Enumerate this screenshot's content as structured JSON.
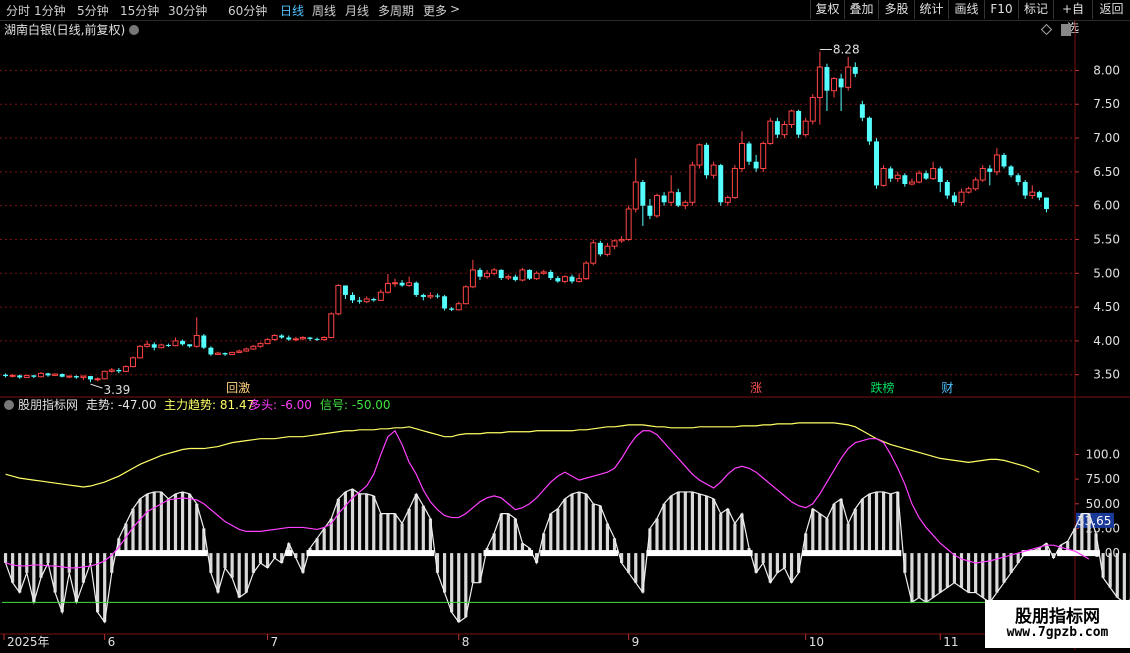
{
  "toolbar": {
    "periods": [
      {
        "label": "分时",
        "active": false
      },
      {
        "label": "1分钟",
        "active": false
      },
      {
        "label": "5分钟",
        "active": false
      },
      {
        "label": "15分钟",
        "active": false
      },
      {
        "label": "30分钟",
        "active": false
      },
      {
        "label": "60分钟",
        "active": false
      },
      {
        "label": "日线",
        "active": true
      },
      {
        "label": "周线",
        "active": false
      },
      {
        "label": "月线",
        "active": false
      },
      {
        "label": "多周期",
        "active": false
      },
      {
        "label": "更多",
        "active": false
      }
    ],
    "more_arrow": ">",
    "right_buttons": [
      "复权",
      "叠加",
      "多股",
      "统计",
      "画线",
      "F10",
      "标记",
      "+自选",
      "返回"
    ]
  },
  "main_chart": {
    "title": "湖南白银(日线,前复权)",
    "price_axis": [
      "8.00",
      "7.50",
      "7.00",
      "6.50",
      "6.00",
      "5.50",
      "5.00",
      "4.50",
      "4.00",
      "3.50"
    ],
    "high_label": "8.28",
    "low_label": "3.39",
    "events": [
      {
        "label": "回激",
        "color": "#ffd27a",
        "index": 32
      },
      {
        "label": "涨",
        "color": "#ff5050",
        "index": 106
      },
      {
        "label": "跌榜",
        "color": "#00e060",
        "index": 123
      },
      {
        "label": "财",
        "color": "#4ec3ff",
        "index": 133
      }
    ]
  },
  "indicator": {
    "name": "股朋指标网",
    "values": [
      {
        "label": "走势:",
        "value": "-47.00",
        "color": "#e6e6e6"
      },
      {
        "label": "主力趋势:",
        "value": "81.47",
        "color": "#ffff66"
      },
      {
        "label": "多头:",
        "value": "-6.00",
        "color": "#ff40ff"
      },
      {
        "label": "信号:",
        "value": "-50.00",
        "color": "#40e040"
      }
    ],
    "axis": [
      "100.0",
      "75.00",
      "50.00",
      "25.00",
      "0.00"
    ],
    "current_value": "33.65"
  },
  "time_axis": [
    {
      "label": "2025年",
      "index": 0
    },
    {
      "label": "6",
      "index": 14
    },
    {
      "label": "7",
      "index": 37
    },
    {
      "label": "8",
      "index": 64
    },
    {
      "label": "9",
      "index": 88
    },
    {
      "label": "10",
      "index": 113
    },
    {
      "label": "11",
      "index": 132
    }
  ],
  "watermark": {
    "line1": "股朋指标网",
    "line2": "www.7gpzb.com"
  },
  "colors": {
    "up": "#ff4444",
    "down": "#54ffff",
    "trend": "#ffff66",
    "bull": "#ff40ff",
    "signal": "#40e040",
    "grid": "#7a1010"
  },
  "chart_data": {
    "type": "candlestick",
    "title": "湖南白银(日线,前复权)",
    "ylim": [
      3.2,
      8.45
    ],
    "candles": [
      [
        3.5,
        3.48,
        3.52,
        3.46
      ],
      [
        3.48,
        3.49,
        3.51,
        3.46
      ],
      [
        3.49,
        3.46,
        3.5,
        3.44
      ],
      [
        3.46,
        3.49,
        3.5,
        3.45
      ],
      [
        3.49,
        3.47,
        3.5,
        3.45
      ],
      [
        3.47,
        3.52,
        3.54,
        3.46
      ],
      [
        3.52,
        3.49,
        3.53,
        3.47
      ],
      [
        3.49,
        3.51,
        3.52,
        3.48
      ],
      [
        3.51,
        3.47,
        3.52,
        3.46
      ],
      [
        3.47,
        3.48,
        3.49,
        3.45
      ],
      [
        3.48,
        3.46,
        3.49,
        3.44
      ],
      [
        3.46,
        3.48,
        3.49,
        3.42
      ],
      [
        3.48,
        3.43,
        3.48,
        3.39
      ],
      [
        3.43,
        3.44,
        3.46,
        3.4
      ],
      [
        3.44,
        3.55,
        3.56,
        3.43
      ],
      [
        3.55,
        3.57,
        3.6,
        3.53
      ],
      [
        3.57,
        3.55,
        3.6,
        3.52
      ],
      [
        3.55,
        3.62,
        3.64,
        3.54
      ],
      [
        3.62,
        3.75,
        3.77,
        3.61
      ],
      [
        3.75,
        3.92,
        3.94,
        3.74
      ],
      [
        3.92,
        3.95,
        4.0,
        3.9
      ],
      [
        3.95,
        3.9,
        3.98,
        3.86
      ],
      [
        3.9,
        3.94,
        3.96,
        3.89
      ],
      [
        3.94,
        3.93,
        3.96,
        3.91
      ],
      [
        3.93,
        4.0,
        4.05,
        3.92
      ],
      [
        4.0,
        3.95,
        4.02,
        3.93
      ],
      [
        3.95,
        3.92,
        3.95,
        3.9
      ],
      [
        3.92,
        4.08,
        4.35,
        3.9
      ],
      [
        4.08,
        3.9,
        4.1,
        3.88
      ],
      [
        3.9,
        3.8,
        3.92,
        3.78
      ],
      [
        3.8,
        3.82,
        3.84,
        3.79
      ],
      [
        3.82,
        3.8,
        3.83,
        3.78
      ],
      [
        3.8,
        3.83,
        3.84,
        3.79
      ],
      [
        3.83,
        3.85,
        3.87,
        3.82
      ],
      [
        3.85,
        3.88,
        3.9,
        3.84
      ],
      [
        3.88,
        3.92,
        3.94,
        3.87
      ],
      [
        3.92,
        3.96,
        3.98,
        3.9
      ],
      [
        3.96,
        4.02,
        4.04,
        3.95
      ],
      [
        4.02,
        4.08,
        4.1,
        4.0
      ],
      [
        4.08,
        4.05,
        4.1,
        4.03
      ],
      [
        4.05,
        4.02,
        4.08,
        4.0
      ],
      [
        4.02,
        4.03,
        4.06,
        4.0
      ],
      [
        4.03,
        4.05,
        4.07,
        4.01
      ],
      [
        4.05,
        4.03,
        4.06,
        4.0
      ],
      [
        4.03,
        4.02,
        4.05,
        4.0
      ],
      [
        4.02,
        4.05,
        4.07,
        4.0
      ],
      [
        4.05,
        4.4,
        4.42,
        4.04
      ],
      [
        4.4,
        4.82,
        4.84,
        4.38
      ],
      [
        4.82,
        4.68,
        4.8,
        4.62
      ],
      [
        4.68,
        4.6,
        4.72,
        4.56
      ],
      [
        4.6,
        4.58,
        4.65,
        4.55
      ],
      [
        4.58,
        4.62,
        4.66,
        4.56
      ],
      [
        4.62,
        4.6,
        4.64,
        4.58
      ],
      [
        4.6,
        4.72,
        4.76,
        4.59
      ],
      [
        4.72,
        4.85,
        4.99,
        4.7
      ],
      [
        4.85,
        4.86,
        4.92,
        4.8
      ],
      [
        4.86,
        4.82,
        4.9,
        4.8
      ],
      [
        4.82,
        4.86,
        4.95,
        4.8
      ],
      [
        4.86,
        4.68,
        4.88,
        4.65
      ],
      [
        4.68,
        4.65,
        4.7,
        4.6
      ],
      [
        4.65,
        4.67,
        4.72,
        4.62
      ],
      [
        4.67,
        4.66,
        4.7,
        4.63
      ],
      [
        4.66,
        4.48,
        4.68,
        4.45
      ],
      [
        4.48,
        4.46,
        4.5,
        4.44
      ],
      [
        4.46,
        4.55,
        4.58,
        4.45
      ],
      [
        4.55,
        4.8,
        4.82,
        4.54
      ],
      [
        4.8,
        5.05,
        5.2,
        4.78
      ],
      [
        5.05,
        4.95,
        5.08,
        4.9
      ],
      [
        4.95,
        5.0,
        5.05,
        4.92
      ],
      [
        5.0,
        5.05,
        5.08,
        4.97
      ],
      [
        5.05,
        4.93,
        5.06,
        4.9
      ],
      [
        4.93,
        4.95,
        4.98,
        4.9
      ],
      [
        4.95,
        4.9,
        4.98,
        4.88
      ],
      [
        4.9,
        5.05,
        5.08,
        4.88
      ],
      [
        5.05,
        4.92,
        5.06,
        4.9
      ],
      [
        4.92,
        5.0,
        5.03,
        4.9
      ],
      [
        5.0,
        5.02,
        5.05,
        4.98
      ],
      [
        5.02,
        4.93,
        5.05,
        4.9
      ],
      [
        4.93,
        4.88,
        4.96,
        4.86
      ],
      [
        4.88,
        4.95,
        4.97,
        4.85
      ],
      [
        4.95,
        4.88,
        4.98,
        4.85
      ],
      [
        4.88,
        4.92,
        5.0,
        4.86
      ],
      [
        4.92,
        5.15,
        5.18,
        4.9
      ],
      [
        5.15,
        5.45,
        5.5,
        5.12
      ],
      [
        5.45,
        5.28,
        5.48,
        5.25
      ],
      [
        5.28,
        5.4,
        5.45,
        5.25
      ],
      [
        5.4,
        5.48,
        5.5,
        5.36
      ],
      [
        5.48,
        5.5,
        5.55,
        5.45
      ],
      [
        5.5,
        5.95,
        6.0,
        5.48
      ],
      [
        5.95,
        6.35,
        6.7,
        5.9
      ],
      [
        6.35,
        6.0,
        6.38,
        5.7
      ],
      [
        6.0,
        5.85,
        6.1,
        5.8
      ],
      [
        5.85,
        6.15,
        6.18,
        5.82
      ],
      [
        6.15,
        6.05,
        6.2,
        6.0
      ],
      [
        6.05,
        6.2,
        6.45,
        6.0
      ],
      [
        6.2,
        6.0,
        6.25,
        5.98
      ],
      [
        6.0,
        6.05,
        6.08,
        5.95
      ],
      [
        6.05,
        6.6,
        6.65,
        6.0
      ],
      [
        6.6,
        6.9,
        6.92,
        6.55
      ],
      [
        6.9,
        6.45,
        6.93,
        6.4
      ],
      [
        6.45,
        6.6,
        6.65,
        6.4
      ],
      [
        6.6,
        6.05,
        6.62,
        6.0
      ],
      [
        6.05,
        6.12,
        6.15,
        6.0
      ],
      [
        6.12,
        6.55,
        6.6,
        6.1
      ],
      [
        6.55,
        6.92,
        7.1,
        6.5
      ],
      [
        6.92,
        6.65,
        6.95,
        6.6
      ],
      [
        6.65,
        6.55,
        6.75,
        6.5
      ],
      [
        6.55,
        6.92,
        6.95,
        6.5
      ],
      [
        6.92,
        7.25,
        7.3,
        6.9
      ],
      [
        7.25,
        7.05,
        7.3,
        7.0
      ],
      [
        7.05,
        7.2,
        7.25,
        7.0
      ],
      [
        7.2,
        7.4,
        7.42,
        7.15
      ],
      [
        7.4,
        7.05,
        7.42,
        7.0
      ],
      [
        7.05,
        7.25,
        7.3,
        7.02
      ],
      [
        7.25,
        7.6,
        7.65,
        7.2
      ],
      [
        7.6,
        8.05,
        8.28,
        7.2
      ],
      [
        8.05,
        7.7,
        8.1,
        7.4
      ],
      [
        7.7,
        7.88,
        7.9,
        7.6
      ],
      [
        7.88,
        7.75,
        7.95,
        7.4
      ],
      [
        7.75,
        8.05,
        8.2,
        7.7
      ],
      [
        8.05,
        7.95,
        8.12,
        7.9
      ],
      [
        7.5,
        7.3,
        7.55,
        7.25
      ],
      [
        7.3,
        6.95,
        7.32,
        6.9
      ],
      [
        6.95,
        6.3,
        7.0,
        6.25
      ],
      [
        6.3,
        6.55,
        6.6,
        6.28
      ],
      [
        6.55,
        6.4,
        6.58,
        6.35
      ],
      [
        6.4,
        6.45,
        6.5,
        6.35
      ],
      [
        6.45,
        6.32,
        6.48,
        6.28
      ],
      [
        6.32,
        6.35,
        6.4,
        6.3
      ],
      [
        6.35,
        6.48,
        6.52,
        6.33
      ],
      [
        6.48,
        6.4,
        6.52,
        6.38
      ],
      [
        6.4,
        6.55,
        6.65,
        6.38
      ],
      [
        6.55,
        6.35,
        6.58,
        6.2
      ],
      [
        6.35,
        6.15,
        6.38,
        6.1
      ],
      [
        6.15,
        6.05,
        6.2,
        6.0
      ],
      [
        6.05,
        6.2,
        6.25,
        6.0
      ],
      [
        6.2,
        6.25,
        6.28,
        6.18
      ],
      [
        6.25,
        6.38,
        6.42,
        6.22
      ],
      [
        6.38,
        6.55,
        6.6,
        6.35
      ],
      [
        6.55,
        6.5,
        6.6,
        6.3
      ],
      [
        6.5,
        6.75,
        6.85,
        6.45
      ],
      [
        6.75,
        6.58,
        6.78,
        6.55
      ],
      [
        6.58,
        6.45,
        6.6,
        6.42
      ],
      [
        6.45,
        6.35,
        6.48,
        6.3
      ],
      [
        6.35,
        6.15,
        6.38,
        6.1
      ],
      [
        6.15,
        6.2,
        6.3,
        6.1
      ],
      [
        6.2,
        6.12,
        6.22,
        6.08
      ],
      [
        6.12,
        5.95,
        6.12,
        5.9
      ]
    ],
    "indicator": {
      "ylim": [
        -80,
        140
      ],
      "trend": [
        80,
        78,
        76,
        75,
        74,
        73,
        72,
        71,
        70,
        69,
        68,
        67,
        68,
        70,
        72,
        75,
        78,
        82,
        86,
        90,
        93,
        96,
        99,
        101,
        103,
        105,
        106,
        106,
        106,
        107,
        108,
        110,
        112,
        113,
        114,
        115,
        116,
        116,
        116,
        117,
        118,
        118,
        118,
        119,
        120,
        121,
        122,
        123,
        124,
        124,
        125,
        125,
        125,
        126,
        126,
        127,
        127,
        128,
        126,
        124,
        122,
        120,
        118,
        118,
        120,
        121,
        121,
        121,
        122,
        122,
        122,
        123,
        123,
        123,
        123,
        124,
        124,
        124,
        124,
        124,
        124,
        125,
        125,
        126,
        127,
        128,
        128,
        129,
        130,
        130,
        130,
        129,
        128,
        128,
        127,
        127,
        127,
        127,
        128,
        128,
        128,
        128,
        128,
        128,
        129,
        129,
        129,
        130,
        130,
        131,
        131,
        131,
        132,
        132,
        132,
        132,
        132,
        132,
        131,
        130,
        128,
        124,
        120,
        116,
        113,
        110,
        108,
        106,
        104,
        102,
        100,
        98,
        96,
        95,
        94,
        93,
        92,
        93,
        94,
        95,
        95,
        94,
        92,
        90,
        88,
        85,
        82
      ],
      "bull": [
        -10,
        -12,
        -13,
        -13,
        -12,
        -12,
        -13,
        -13,
        -14,
        -15,
        -15,
        -14,
        -13,
        -11,
        -8,
        -2,
        6,
        16,
        26,
        34,
        42,
        46,
        50,
        54,
        55,
        56,
        55,
        54,
        50,
        44,
        38,
        32,
        28,
        24,
        22,
        22,
        22,
        23,
        24,
        25,
        26,
        26,
        26,
        25,
        24,
        26,
        30,
        40,
        48,
        56,
        62,
        68,
        80,
        100,
        118,
        124,
        110,
        92,
        80,
        64,
        52,
        44,
        38,
        36,
        36,
        40,
        46,
        52,
        56,
        58,
        56,
        50,
        44,
        46,
        50,
        56,
        64,
        72,
        78,
        82,
        78,
        74,
        76,
        78,
        80,
        82,
        86,
        96,
        108,
        118,
        124,
        124,
        120,
        112,
        104,
        96,
        88,
        80,
        74,
        70,
        66,
        72,
        80,
        86,
        88,
        86,
        82,
        76,
        70,
        64,
        58,
        52,
        48,
        46,
        50,
        60,
        72,
        84,
        96,
        106,
        112,
        114,
        116,
        116,
        112,
        100,
        86,
        70,
        50,
        36,
        26,
        18,
        10,
        4,
        -2,
        -6,
        -8,
        -10,
        -9,
        -8,
        -6,
        -4,
        -2,
        0,
        2,
        4,
        6,
        8,
        8,
        6,
        4,
        2,
        -2,
        -6
      ],
      "walk": [
        -10,
        -30,
        -40,
        -20,
        -50,
        -25,
        -10,
        -40,
        -60,
        -20,
        -50,
        -30,
        -10,
        -60,
        -70,
        -20,
        15,
        30,
        45,
        55,
        60,
        62,
        62,
        55,
        60,
        62,
        60,
        50,
        25,
        -20,
        -40,
        -15,
        -25,
        -45,
        -40,
        -20,
        -10,
        -15,
        -5,
        -10,
        10,
        -5,
        -20,
        5,
        15,
        25,
        35,
        55,
        62,
        65,
        60,
        60,
        58,
        40,
        40,
        40,
        30,
        45,
        60,
        48,
        35,
        -20,
        -40,
        -60,
        -70,
        -65,
        -30,
        -30,
        5,
        20,
        40,
        40,
        35,
        10,
        5,
        -10,
        20,
        40,
        45,
        55,
        60,
        62,
        60,
        50,
        48,
        30,
        15,
        -10,
        -20,
        -30,
        -40,
        25,
        35,
        50,
        58,
        62,
        62,
        62,
        60,
        58,
        55,
        40,
        45,
        30,
        40,
        5,
        -20,
        -10,
        -30,
        -20,
        -15,
        -30,
        -20,
        20,
        45,
        40,
        35,
        50,
        55,
        30,
        45,
        55,
        60,
        62,
        62,
        60,
        62,
        -20,
        -50,
        -45,
        -50,
        -45,
        -40,
        -35,
        -30,
        -35,
        -40,
        -40,
        -45,
        -50,
        -40,
        -30,
        -20,
        -10,
        0,
        2,
        5,
        10,
        -5,
        8,
        12,
        25,
        40,
        40,
        20,
        -25,
        -35,
        -45,
        -50,
        -47
      ],
      "signal": -50
    }
  }
}
